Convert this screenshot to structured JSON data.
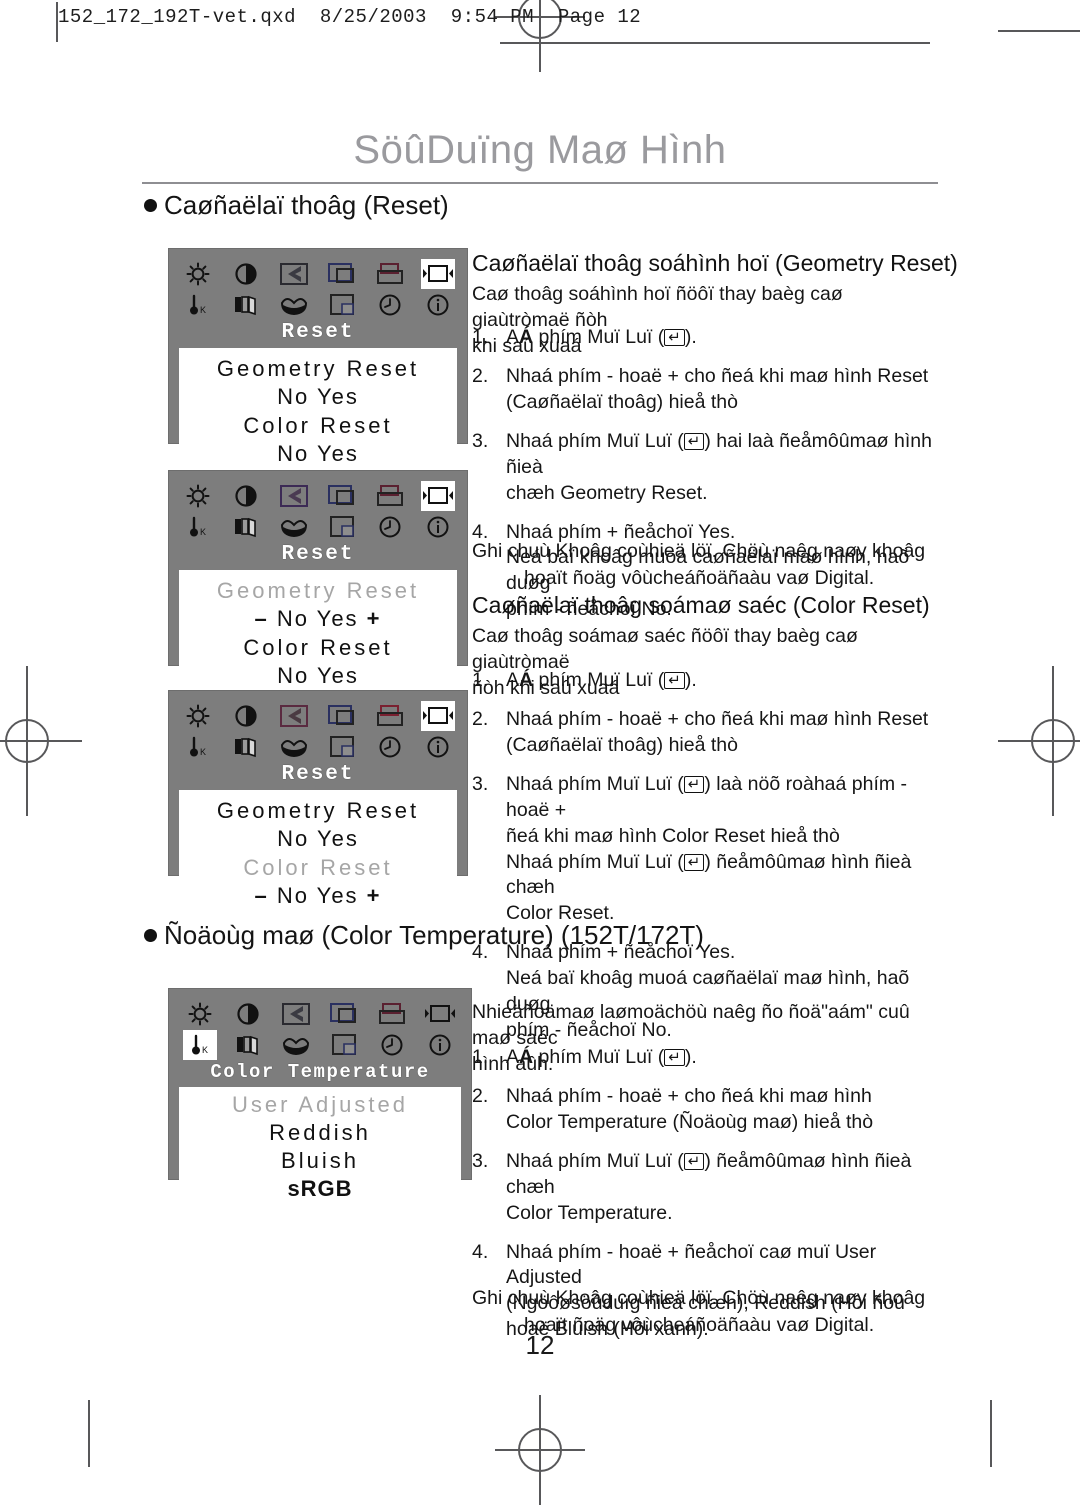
{
  "file_header": "152_172_192T-vet.qxd  8/25/2003  9:54 PM  Page 12",
  "doc_title": "SöûDuïng Maø Hình",
  "page_number": "12",
  "key_symbol": "↵",
  "sections": [
    {
      "bullet": "Caøñaëlaï thoâg (Reset)"
    },
    {
      "bullet": "Ñoäoùg maø (Color Temperature) (152T/172T)"
    }
  ],
  "osd_menus": [
    {
      "name": "reset-menu-1",
      "title": "Reset",
      "selected_icon": "reset-icon",
      "icons_row1": [
        "brightness-icon",
        "contrast-icon",
        "trapezoid-icon",
        "pincushion-icon",
        "position-icon",
        "reset-icon"
      ],
      "icons_row2": [
        "color-temperature-icon",
        "color-balance-icon",
        "hue-icon",
        "osd-position-icon",
        "timer-icon",
        "information-icon"
      ],
      "items": [
        {
          "label": "Geometry Reset",
          "dim": false,
          "options": "No      Yes",
          "minus": false,
          "plus": false
        },
        {
          "label": "Color Reset",
          "dim": false,
          "options": "No      Yes",
          "minus": false,
          "plus": false
        }
      ]
    },
    {
      "name": "reset-menu-2",
      "title": "Reset",
      "selected_icon": "reset-icon",
      "icons_row1": [
        "brightness-icon",
        "contrast-icon",
        "trapezoid-icon",
        "pincushion-icon",
        "position-icon",
        "reset-icon"
      ],
      "icons_row2": [
        "color-temperature-icon",
        "color-balance-icon",
        "hue-icon",
        "osd-position-icon",
        "timer-icon",
        "information-icon"
      ],
      "items": [
        {
          "label": "Geometry Reset",
          "dim": true,
          "options": "No      Yes",
          "minus": true,
          "plus": true
        },
        {
          "label": "Color Reset",
          "dim": false,
          "options": "No      Yes",
          "minus": false,
          "plus": false
        }
      ]
    },
    {
      "name": "reset-menu-3",
      "title": "Reset",
      "selected_icon": "reset-icon",
      "icons_row1": [
        "brightness-icon",
        "contrast-icon",
        "trapezoid-icon",
        "pincushion-icon",
        "position-icon",
        "reset-icon"
      ],
      "icons_row2": [
        "color-temperature-icon",
        "color-balance-icon",
        "hue-icon",
        "osd-position-icon",
        "timer-icon",
        "information-icon"
      ],
      "items": [
        {
          "label": "Geometry Reset",
          "dim": false,
          "options": "No      Yes",
          "minus": false,
          "plus": false
        },
        {
          "label": "Color Reset",
          "dim": true,
          "options": "No      Yes",
          "minus": true,
          "plus": true
        }
      ]
    },
    {
      "name": "color-temperature-menu",
      "title": "Color Temperature",
      "selected_icon": "color-temperature-icon",
      "icons_row1": [
        "brightness-icon",
        "contrast-icon",
        "trapezoid-icon",
        "pincushion-icon",
        "position-icon",
        "reset-icon"
      ],
      "icons_row2": [
        "color-temperature-icon",
        "color-balance-icon",
        "hue-icon",
        "osd-position-icon",
        "timer-icon",
        "information-icon"
      ],
      "options": [
        {
          "label": "User Adjusted",
          "dim": true,
          "bold": false
        },
        {
          "label": "Reddish",
          "dim": false,
          "bold": false
        },
        {
          "label": "Bluish",
          "dim": false,
          "bold": false
        },
        {
          "label": "sRGB",
          "dim": false,
          "bold": true
        }
      ]
    }
  ],
  "geometry_reset": {
    "heading": "Caøñaëlaï thoâg soáhình hoï (Geometry Reset)",
    "intro_line1": "Caø thoâg soáhình hoï ñöôï thay baèg caø giaùtròmaë ñòh",
    "intro_line2": "khi saû xuaá",
    "steps": [
      {
        "num": "1.",
        "lines": [
          "AábphímbMuïcbLuïcb(KEY)."
        ]
      },
      {
        "num": "2.",
        "lines": [
          "Nhaá phím - hoaë + cho ñeá khi maø hình Reset",
          "(Caøñaëlaï thoâg) hieå thò"
        ]
      },
      {
        "num": "3.",
        "lines": [
          "Nhaá phím Muï Luï (KEY) hai laà ñeåmôûmaø hình ñieà",
          "chæh Geometry Reset."
        ]
      },
      {
        "num": "4.",
        "lines": [
          "Nhaá phím + ñeåchoï Yes.",
          "Neá baï khoâg muoá caøñaëlaï maø hình, haõ duøg",
          "phím - ñeåchoï No."
        ]
      }
    ],
    "note_line1": "Ghi chuù Khoâg coùhieä löï. Chöù naêg naøy khoâg",
    "note_line2": "hoaït ñoäg vôùcheáñoäñaàu vaø Digital."
  },
  "color_reset": {
    "heading": "Caøñaëlaï thoâg soámaø saéc (Color Reset)",
    "intro_line1": "Caø thoâg soámaø saéc ñöôï thay baèg caø giaùtròmaë",
    "intro_line2": "ñòh khi saû xuaá",
    "steps": [
      {
        "num": "1.",
        "lines": [
          "AábphímbMuïcbLuïcb(KEY)."
        ]
      },
      {
        "num": "2.",
        "lines": [
          "Nhaá phím - hoaë + cho ñeá khi maø hình Reset",
          "(Caøñaëlaï thoâg) hieå thò"
        ]
      },
      {
        "num": "3.",
        "lines": [
          "Nhaá phím Muï Luï (KEY) laà nöõ roàhaá phím - hoaë +",
          "ñeá khi maø hình Color Reset hieå thò",
          "Nhaá phím Muï Luï (KEY) ñeåmôûmaø hình ñieà chæh",
          "Color Reset."
        ]
      },
      {
        "num": "4.",
        "lines": [
          "Nhaá phím + ñeåchoï Yes.",
          "Neá baï khoâg muoá caøñaëlaï maø hình, haõ duøg",
          "phím - ñeåchoï No."
        ]
      }
    ]
  },
  "color_temperature": {
    "intro_line1": "Nhieäñoämaø laømoächöù naêg ño ñoä\"aám\" cuû maø saéc",
    "intro_line2": "hình aûh.",
    "steps": [
      {
        "num": "1.",
        "lines": [
          "AábphímbMuïcbLuïcb(KEY)."
        ]
      },
      {
        "num": "2.",
        "lines": [
          "Nhaá phím - hoaë + cho ñeá khi maø hình",
          "Color Temperature (Ñoäoùg maø) hieå thò"
        ]
      },
      {
        "num": "3.",
        "lines": [
          "Nhaá phím Muï Luï (KEY) ñeåmôûmaø hình ñieà chæh",
          "Color Temperature."
        ]
      },
      {
        "num": "4.",
        "lines": [
          "Nhaá phím - hoaë + ñeåchoï caø muï User Adjusted",
          "(Ngöôøsöûduïg ñieà chæh), Reddish (Hôi ñoû",
          "hoaë Bluish (Hôi xanh)."
        ]
      }
    ],
    "note_line1": "Ghi chuù Khoâg coùhieä löï. Chöù naêg naøy khoâg",
    "note_line2": "hoaït ñoäg vôùcheáñoäñaàu vaø Digital."
  }
}
